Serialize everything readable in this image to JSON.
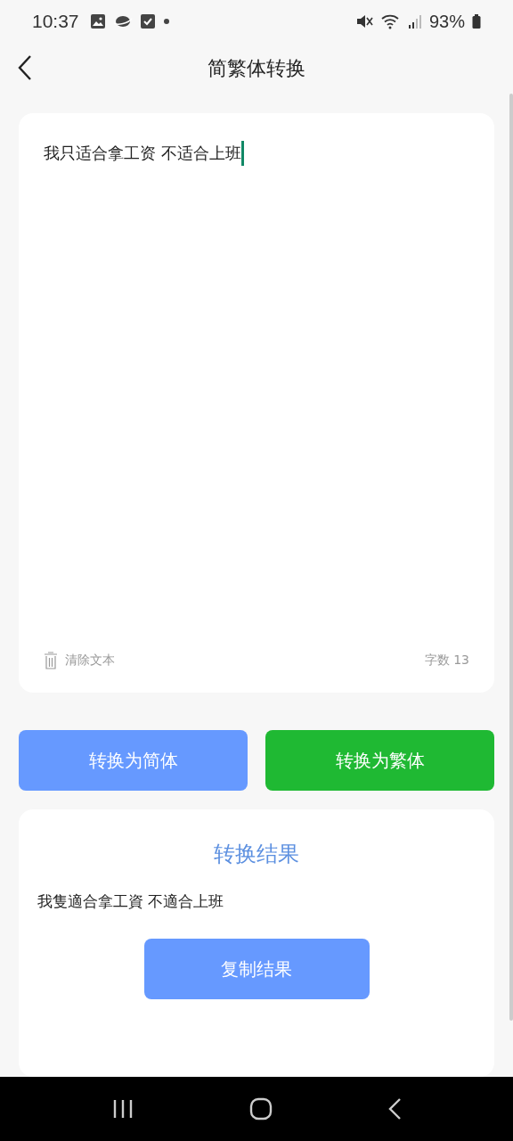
{
  "status_bar": {
    "time": "10:37",
    "battery": "93%"
  },
  "header": {
    "title": "简繁体转换"
  },
  "input": {
    "value": "我只适合拿工资 不适合上班",
    "clear_label": "清除文本",
    "count": "字数 13"
  },
  "buttons": [
    {
      "label": "转换为简体",
      "kind": "simplified"
    },
    {
      "label": "转换为繁体",
      "kind": "traditional"
    }
  ],
  "result": {
    "title": "转换结果",
    "text": "我隻適合拿工資 不適合上班",
    "copy_label": "复制结果"
  }
}
